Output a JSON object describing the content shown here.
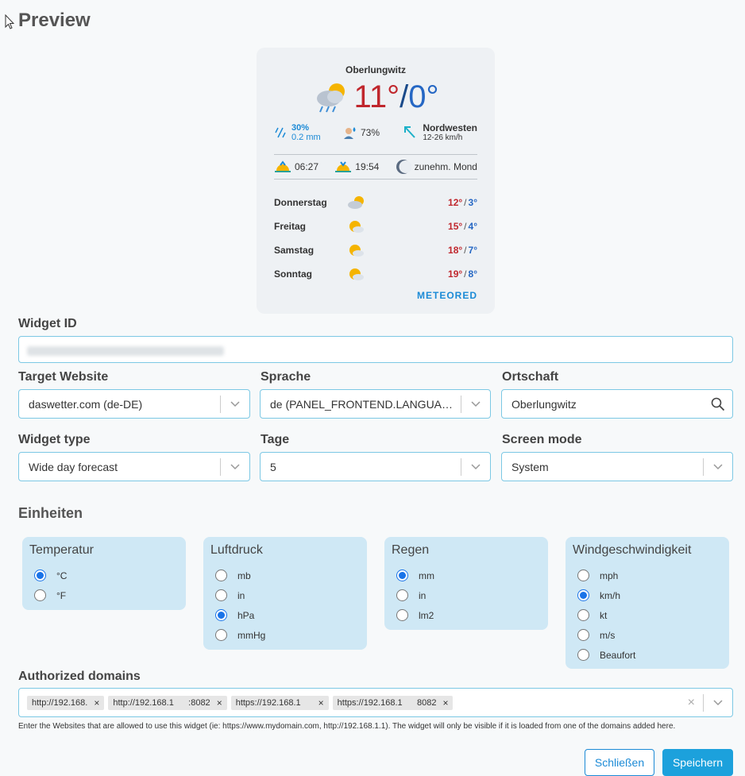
{
  "header": {
    "title": "Preview"
  },
  "widget": {
    "city": "Oberlungwitz",
    "temp_high": "11°",
    "temp_sep": "/",
    "temp_low": "0°",
    "rain_pct": "30%",
    "rain_mm": "0.2 mm",
    "humidity": "73%",
    "wind_dir": "Nordwesten",
    "wind_speed": "12-26 km/h",
    "sunrise": "06:27",
    "sunset": "19:54",
    "moon": "zunehm. Mond",
    "days": [
      {
        "name": "Donnerstag",
        "high": "12°",
        "sep": "/",
        "low": "3°"
      },
      {
        "name": "Freitag",
        "high": "15°",
        "sep": "/",
        "low": "4°"
      },
      {
        "name": "Samstag",
        "high": "18°",
        "sep": "/",
        "low": "7°"
      },
      {
        "name": "Sonntag",
        "high": "19°",
        "sep": "/",
        "low": "8°"
      }
    ],
    "brand": "METEORED"
  },
  "form": {
    "widget_id_label": "Widget ID",
    "target_label": "Target Website",
    "target_value": "daswetter.com (de-DE)",
    "sprache_label": "Sprache",
    "sprache_value": "de (PANEL_FRONTEND.LANGUAGE...",
    "ortschaft_label": "Ortschaft",
    "ortschaft_value": "Oberlungwitz",
    "type_label": "Widget type",
    "type_value": "Wide day forecast",
    "tage_label": "Tage",
    "tage_value": "5",
    "screen_label": "Screen mode",
    "screen_value": "System"
  },
  "units": {
    "title": "Einheiten",
    "groups": [
      {
        "title": "Temperatur",
        "options": [
          "°C",
          "°F"
        ],
        "selected": "°C"
      },
      {
        "title": "Luftdruck",
        "options": [
          "mb",
          "in",
          "hPa",
          "mmHg"
        ],
        "selected": "hPa"
      },
      {
        "title": "Regen",
        "options": [
          "mm",
          "in",
          "lm2"
        ],
        "selected": "mm"
      },
      {
        "title": "Windgeschwindigkeit",
        "options": [
          "mph",
          "km/h",
          "kt",
          "m/s",
          "Beaufort"
        ],
        "selected": "km/h"
      }
    ]
  },
  "domains": {
    "label": "Authorized domains",
    "tags": [
      "http://192.168.",
      "http://192.168.1      :8082",
      "https://192.168.1",
      "https://192.168.1      8082"
    ],
    "help": "Enter the Websites that are allowed to use this widget (ie: https://www.mydomain.com, http://192.168.1.1). The widget will only be visible if it is loaded from one of the domains added here."
  },
  "buttons": {
    "close": "Schließen",
    "save": "Speichern"
  },
  "colors": {
    "accent": "#1ca1dc",
    "temp_high": "#c0272d",
    "temp_low": "#2567c4",
    "unit_box": "#cfe8f5"
  }
}
